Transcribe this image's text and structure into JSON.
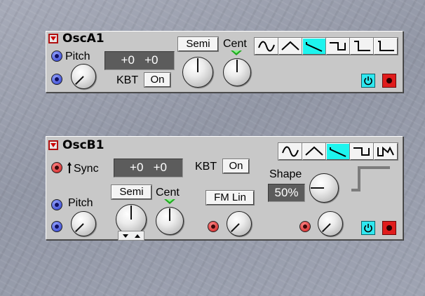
{
  "osc_a": {
    "title": "OscA1",
    "pitch_label": "Pitch",
    "display_text": "+0   +0",
    "kbt_label": "KBT",
    "kbt_value": "On",
    "semi_button": "Semi",
    "cent_label": "Cent",
    "waveforms": [
      "sine-wave-icon",
      "triangle-wave-icon",
      "saw-wave-icon",
      "square-wave-icon",
      "pulse-wave-icon",
      "narrow-pulse-wave-icon"
    ],
    "selected_waveform": "saw-wave-icon"
  },
  "osc_b": {
    "title": "OscB1",
    "sync_label": "Sync",
    "display_text": "+0   +0",
    "kbt_label": "KBT",
    "kbt_value": "On",
    "pitch_label": "Pitch",
    "semi_button": "Semi",
    "cent_label": "Cent",
    "fm_button": "FM Lin",
    "shape_label": "Shape",
    "shape_value": "50%",
    "waveforms": [
      "sine-wave-icon",
      "triangle-wave-icon",
      "saw-wave-icon",
      "square-wave-icon",
      "saw-pulse-wave-icon"
    ],
    "selected_waveform": "saw-wave-icon"
  },
  "colors": {
    "selected_wave": "#1ef4ee",
    "power_button": "#2fe8f0",
    "record_button": "#e01c1c",
    "panel": "#c8c8c8",
    "display_bg": "#5c5c5c"
  }
}
